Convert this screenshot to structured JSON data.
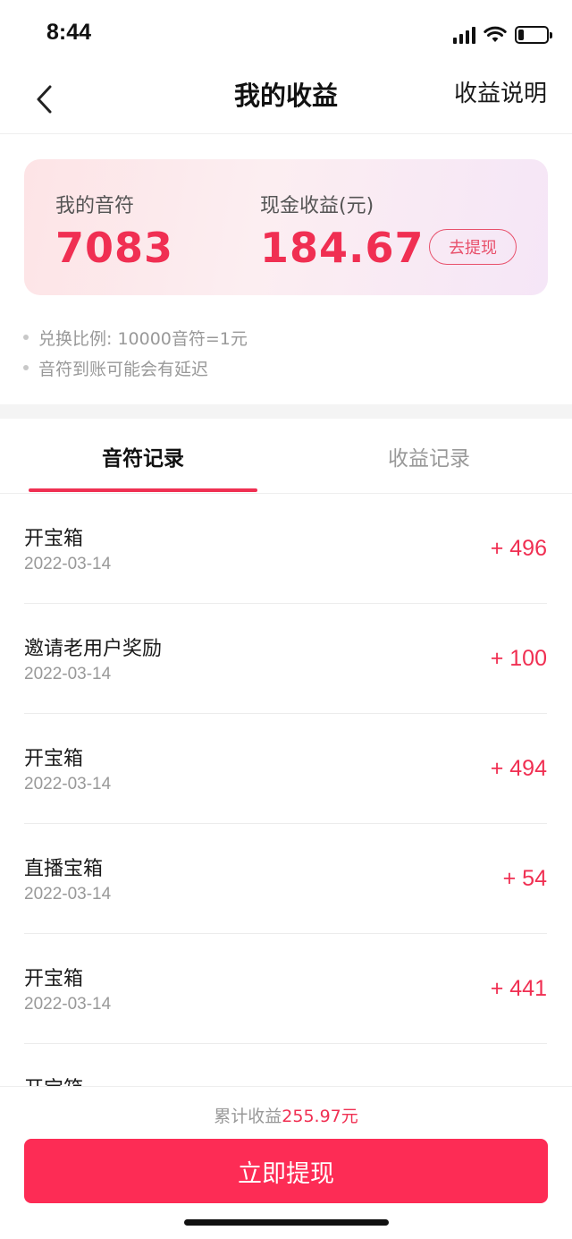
{
  "status_bar": {
    "time": "8:44",
    "signal_icon": "cellular-signal-icon",
    "wifi_icon": "wifi-icon",
    "battery_icon": "battery-icon",
    "battery_level": 0.2
  },
  "nav": {
    "back_icon": "chevron-left-icon",
    "title": "我的收益",
    "explain": "收益说明"
  },
  "card": {
    "notes_label": "我的音符",
    "notes_value": "7083",
    "cash_label": "现金收益(元)",
    "cash_value": "184.67",
    "withdraw_label": "去提现"
  },
  "notes": [
    "兑换比例: 10000音符=1元",
    "音符到账可能会有延迟"
  ],
  "tabs": [
    {
      "label": "音符记录",
      "active": true
    },
    {
      "label": "收益记录",
      "active": false
    }
  ],
  "records": [
    {
      "title": "开宝箱",
      "date": "2022-03-14",
      "amount": "+ 496"
    },
    {
      "title": "邀请老用户奖励",
      "date": "2022-03-14",
      "amount": "+ 100"
    },
    {
      "title": "开宝箱",
      "date": "2022-03-14",
      "amount": "+ 494"
    },
    {
      "title": "直播宝箱",
      "date": "2022-03-14",
      "amount": "+ 54"
    },
    {
      "title": "开宝箱",
      "date": "2022-03-14",
      "amount": "+ 441"
    },
    {
      "title": "开宝箱",
      "date": "",
      "amount": ""
    }
  ],
  "footer": {
    "total_label": "累计收益",
    "total_value": "255.97元",
    "withdraw_button": "立即提现"
  },
  "colors": {
    "accent": "#f02f52",
    "button": "#fd2c55",
    "muted_text": "#999999"
  }
}
